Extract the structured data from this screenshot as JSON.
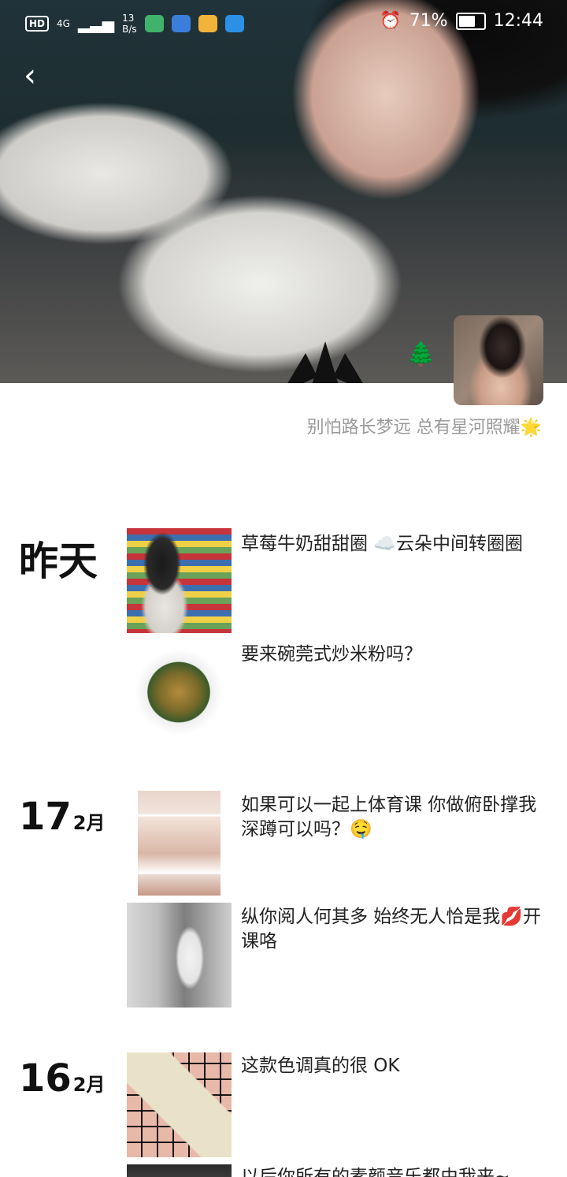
{
  "status_bar": {
    "hd": "HD",
    "network": "4G",
    "speed_value": "13",
    "speed_unit": "B/s",
    "battery": "71%",
    "time": "12:44"
  },
  "profile": {
    "signature": "别怕路长梦远 总有星河照耀",
    "signature_emoji": "🌟"
  },
  "timeline": [
    {
      "date": "昨天",
      "posts": [
        {
          "text": "草莓牛奶甜甜圈 ☁️云朵中间转圈圈"
        },
        {
          "text": "要来碗莞式炒米粉吗？"
        }
      ]
    },
    {
      "day": "17",
      "month": "2月",
      "posts": [
        {
          "text": "如果可以一起上体育课 你做俯卧撑我深蹲可以吗？🤤"
        },
        {
          "text": "纵你阅人何其多 始终无人恰是我💋开课咯"
        }
      ]
    },
    {
      "day": "16",
      "month": "2月",
      "posts": [
        {
          "text": "这款色调真的很 OK"
        },
        {
          "text": "以后你所有的素颜音乐都由我来~"
        }
      ]
    }
  ],
  "icons": {
    "back": "chevron-left-icon",
    "tree": "christmas-tree-icon",
    "alarm": "alarm-icon"
  }
}
